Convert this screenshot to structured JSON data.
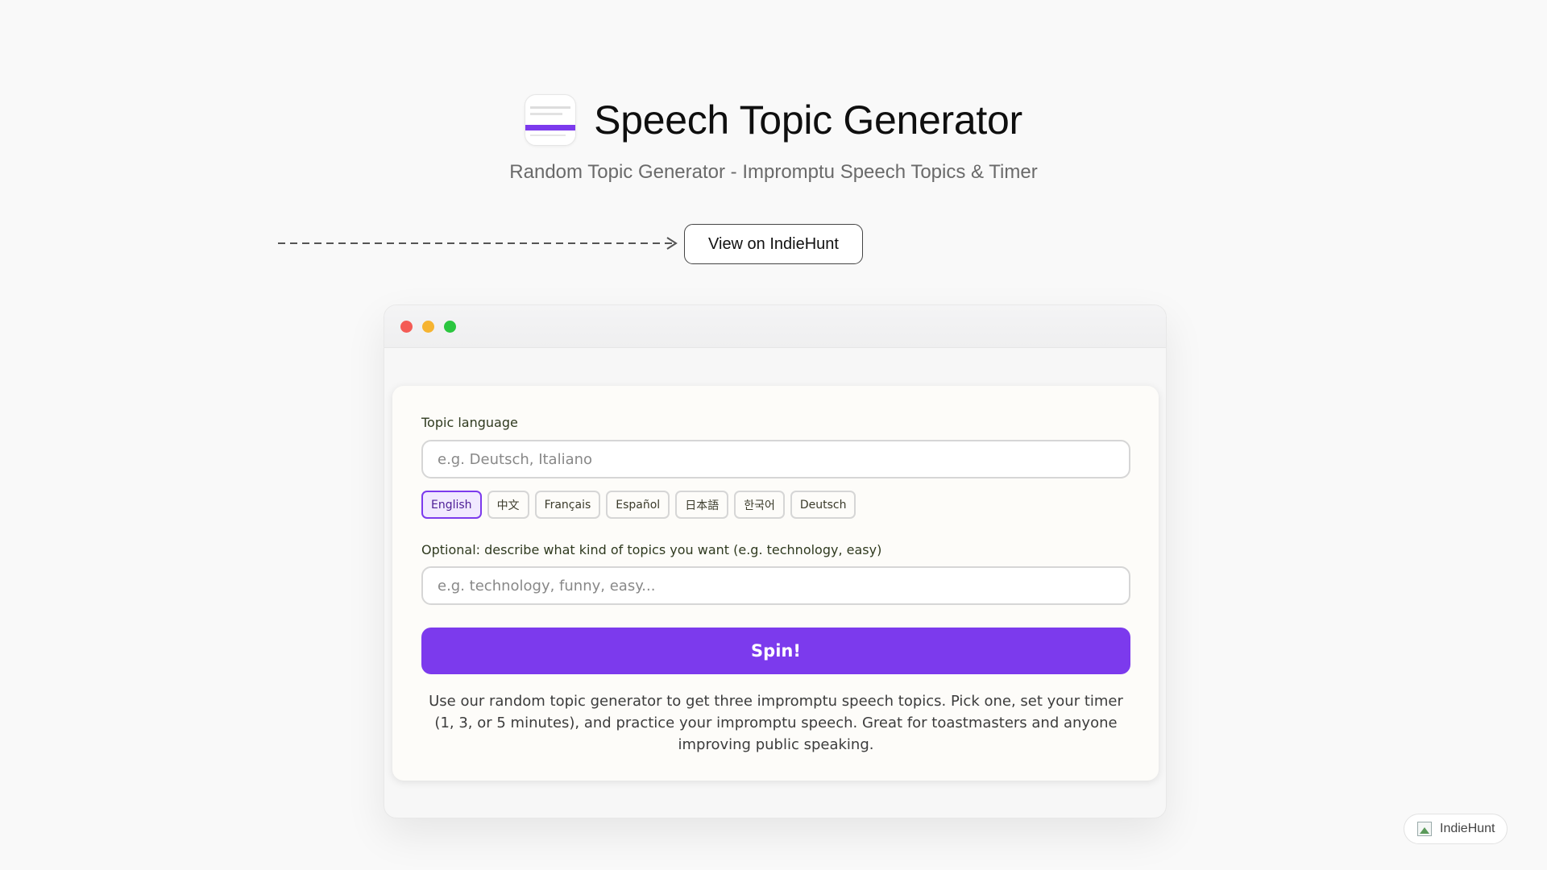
{
  "header": {
    "title": "Speech Topic Generator",
    "subtitle": "Random Topic Generator - Impromptu Speech Topics & Timer",
    "icon": "app-thumbnail"
  },
  "cta": {
    "label": "View on IndieHunt"
  },
  "form": {
    "language_label": "Topic language",
    "language_placeholder": "e.g. Deutsch, Italiano",
    "language_chips": [
      {
        "label": "English",
        "selected": true
      },
      {
        "label": "中文",
        "selected": false
      },
      {
        "label": "Français",
        "selected": false
      },
      {
        "label": "Español",
        "selected": false
      },
      {
        "label": "日本語",
        "selected": false
      },
      {
        "label": "한국어",
        "selected": false
      },
      {
        "label": "Deutsch",
        "selected": false
      }
    ],
    "topic_label": "Optional: describe what kind of topics you want (e.g. technology, easy)",
    "topic_placeholder": "e.g. technology, funny, easy...",
    "spin_label": "Spin!",
    "description": "Use our random topic generator to get three impromptu speech topics. Pick one, set your timer (1, 3, or 5 minutes), and practice your impromptu speech. Great for toastmasters and anyone improving public speaking."
  },
  "badge": {
    "label": "IndieHunt",
    "icon": "broken-image-icon"
  },
  "colors": {
    "accent": "#7c3aed",
    "selected_chip_bg": "#f1e9ff",
    "close_dot": "#f45b55",
    "minimize_dot": "#f6b431",
    "maximize_dot": "#2bc63f"
  }
}
